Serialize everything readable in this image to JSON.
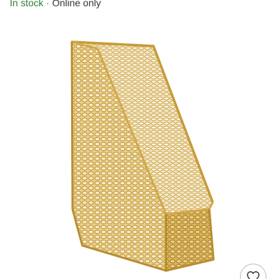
{
  "availability": {
    "status": "In stock",
    "separator": "·",
    "channel": "Online only"
  },
  "product_image": {
    "alt": "Gold wire mesh magazine file holder",
    "color": "#cfa64a"
  },
  "favorite_button": {
    "icon": "heart-icon",
    "label": "Add to favorites"
  }
}
